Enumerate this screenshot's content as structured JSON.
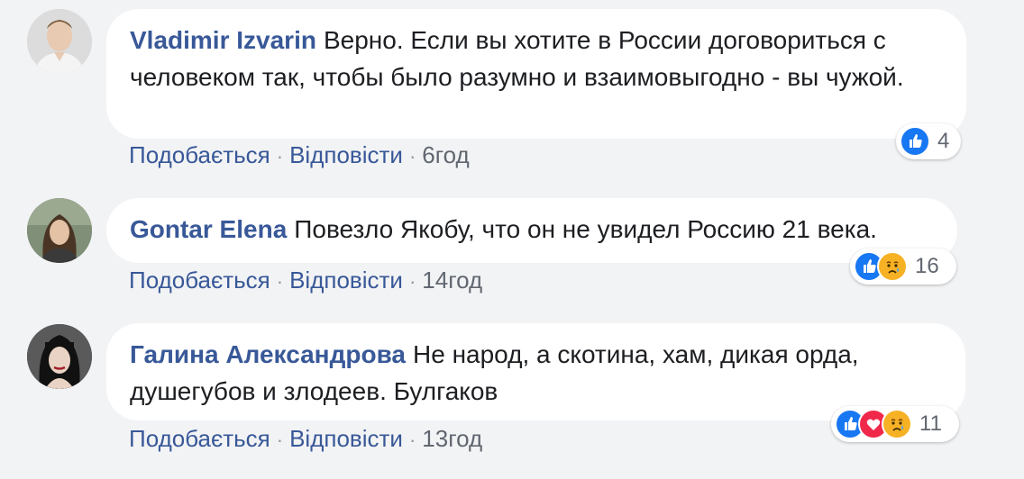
{
  "colors": {
    "background": "#f2f3f5",
    "bubble": "#ffffff",
    "author": "#385898",
    "link": "#385898",
    "meta": "#616770",
    "like": "#1877f2",
    "love": "#f0284a",
    "sad": "#f7b125"
  },
  "actions": {
    "like_label": "Подобається",
    "reply_label": "Відповісти",
    "separator": "·"
  },
  "comments": [
    {
      "author": "Vladimir Izvarin",
      "text": "Верно. Если вы хотите в России договориться с человеком так, чтобы было разумно и взаимовыгодно - вы чужой.",
      "time": "6год",
      "reactions": [
        "like-icon"
      ],
      "reaction_count": "4"
    },
    {
      "author": "Gontar Elena",
      "text": "Повезло Якобу, что он не увидел Россию 21 века.",
      "time": "14год",
      "reactions": [
        "like-icon",
        "sad-icon"
      ],
      "reaction_count": "16"
    },
    {
      "author": "Галина Александрова",
      "text": "Не народ, а скотина, хам, дикая орда, душегубов и злодеев. Булгаков",
      "time": "13год",
      "reactions": [
        "like-icon",
        "love-icon",
        "sad-icon"
      ],
      "reaction_count": "11"
    }
  ]
}
